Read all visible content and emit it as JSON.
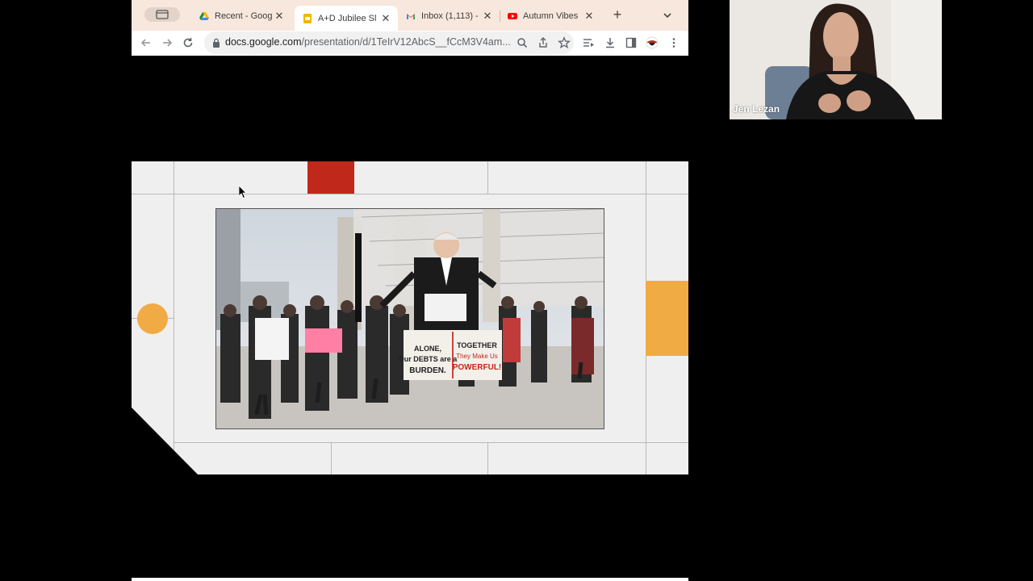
{
  "browser": {
    "tabs": [
      {
        "title": "Recent - Goog",
        "favicon": "google-drive-icon",
        "active": false
      },
      {
        "title": "A+D Jubilee Sl",
        "favicon": "google-slides-icon",
        "active": true
      },
      {
        "title": "Inbox (1,113) -",
        "favicon": "gmail-icon",
        "active": false
      },
      {
        "title": "Autumn Vibes",
        "favicon": "youtube-icon",
        "active": false
      }
    ],
    "url_host": "docs.google.com",
    "url_path": "/presentation/d/1TeIrV12AbcS__fCcM3V4am...",
    "colors": {
      "tabstrip": "#f8e7dc",
      "toolbar": "#ffffff"
    }
  },
  "slide": {
    "photo_sign_texts": [
      "ALONE, Our DEBTS are a BURDEN.",
      "TOGETHER They Make Us POWERFUL!"
    ],
    "colors": {
      "accent_red": "#c0281b",
      "accent_orange": "#f0ab45",
      "background": "#efefef"
    }
  },
  "video": {
    "participant_name": "Jen Lezan"
  }
}
